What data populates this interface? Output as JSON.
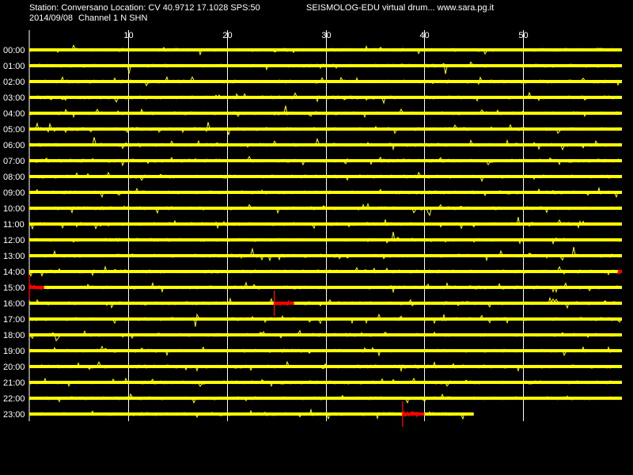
{
  "header": {
    "station_line": "Station: Conversano Location: CV 40.9712 17.1028 SPS:50",
    "title": "SEISMOLOG-EDU virtual drum... www.sara.pg.it",
    "date": "2014/09/08",
    "channel": "Channel 1 N SHN"
  },
  "colors": {
    "background": "#000000",
    "trace": "#ffff00",
    "event": "#ff0000",
    "grid": "#ffffff",
    "text": "#ffffff"
  },
  "chart_data": {
    "type": "line",
    "title": "",
    "xlabel": "",
    "ylabel": "",
    "xlim": [
      0,
      60
    ],
    "x_ticks": [
      10,
      20,
      30,
      40,
      50
    ],
    "y_labels": [
      "00:00",
      "01:00",
      "02:00",
      "03:00",
      "04:00",
      "05:00",
      "06:00",
      "07:00",
      "08:00",
      "09:00",
      "10:00",
      "11:00",
      "12:00",
      "13:00",
      "14:00",
      "15:00",
      "16:00",
      "17:00",
      "18:00",
      "19:00",
      "20:00",
      "21:00",
      "22:00",
      "23:00"
    ],
    "grid": true,
    "trace_end_minute": 45,
    "events": [
      {
        "hour": "14:00",
        "start_min": 59.6,
        "end_min": 60
      },
      {
        "hour": "15:00",
        "start_min": 0,
        "end_min": 1.5
      },
      {
        "hour": "16:00",
        "start_min": 24.8,
        "end_min": 26.8
      },
      {
        "hour": "23:00",
        "start_min": 37.8,
        "end_min": 40
      }
    ]
  }
}
